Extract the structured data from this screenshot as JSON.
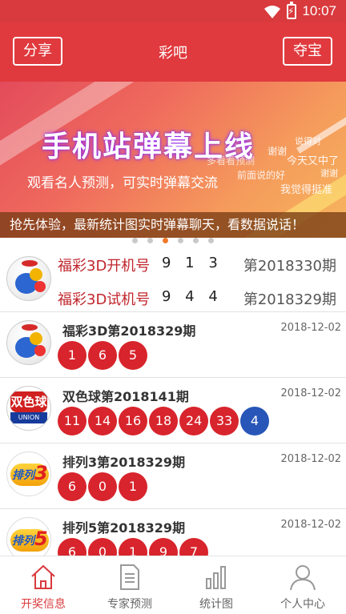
{
  "status_bar": {
    "time": "10:07"
  },
  "header": {
    "title": "彩吧",
    "left_button": "分享",
    "right_button": "夺宝"
  },
  "banner": {
    "headline": "手机站弹幕上线",
    "subtitle": "观看名人预测，可实时弹幕交流",
    "bubbles": [
      "说得对",
      "谢谢",
      "今天又中了",
      "多看看预测",
      "前面说的好",
      "谢谢",
      "我觉得挺准"
    ],
    "caption": "抢先体验，最新统计图实时弹幕聊天，看数据说话！",
    "page_count": 6,
    "active_page": 2
  },
  "live_draw": {
    "rows": [
      {
        "label": "福彩3D开机号",
        "numbers": "9 1 3",
        "issue": "第2018330期"
      },
      {
        "label": "福彩3D试机号",
        "numbers": "9 4 4",
        "issue": "第2018329期"
      }
    ]
  },
  "results": [
    {
      "logo": "fc3d-logo",
      "name": "福彩3D第2018329期",
      "date": "2018-12-02",
      "red": [
        "1",
        "6",
        "5"
      ],
      "blue": []
    },
    {
      "logo": "ssq-logo",
      "name": "双色球第2018141期",
      "date": "2018-12-02",
      "red": [
        "11",
        "14",
        "16",
        "18",
        "24",
        "33"
      ],
      "blue": [
        "4"
      ]
    },
    {
      "logo": "pl3-logo",
      "name": "排列3第2018329期",
      "date": "2018-12-02",
      "red": [
        "6",
        "0",
        "1"
      ],
      "blue": []
    },
    {
      "logo": "pl5-logo",
      "name": "排列5第2018329期",
      "date": "2018-12-02",
      "red": [
        "6",
        "0",
        "1",
        "9",
        "7"
      ],
      "blue": []
    }
  ],
  "logos": {
    "ssq_top": "双色球",
    "ssq_bottom": "UNION LOTTO",
    "pl_text": "排列",
    "pl3_digit": "3",
    "pl5_digit": "5"
  },
  "bottom_nav": {
    "items": [
      {
        "label": "开奖信息",
        "icon": "home-icon",
        "active": true
      },
      {
        "label": "专家预测",
        "icon": "document-icon",
        "active": false
      },
      {
        "label": "统计图",
        "icon": "bar-chart-icon",
        "active": false
      },
      {
        "label": "个人中心",
        "icon": "person-icon",
        "active": false
      }
    ]
  },
  "colors": {
    "brand_red": "#e03a3e",
    "ball_red": "#d8242c",
    "ball_blue": "#2756b8",
    "active_tab": "#d93a3d"
  }
}
